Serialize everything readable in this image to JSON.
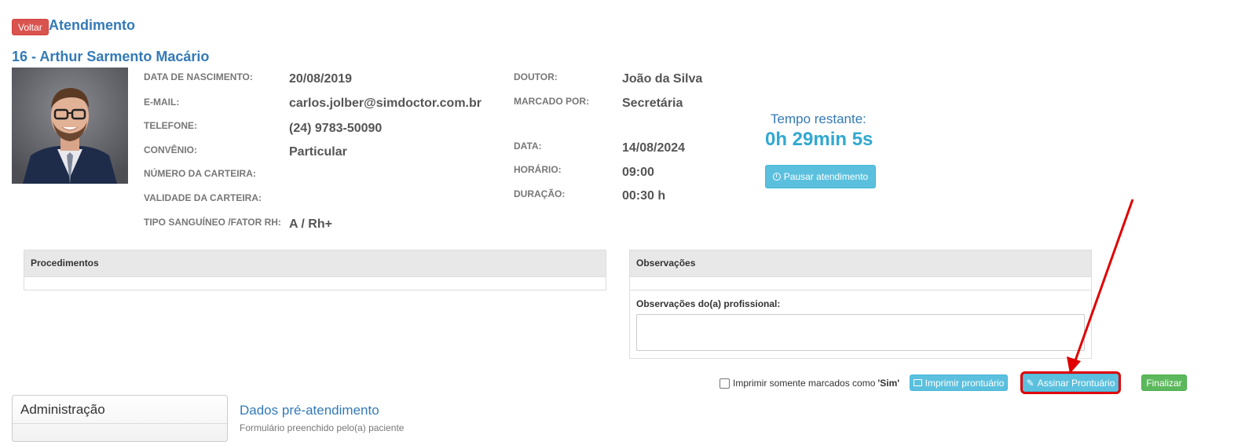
{
  "header": {
    "back_label": "Voltar",
    "title": "Atendimento"
  },
  "patient": {
    "name": "16 - Arthur Sarmento Macário",
    "fields_left": [
      {
        "label": "DATA DE NASCIMENTO:",
        "value": "20/08/2019"
      },
      {
        "label": "E-MAIL:",
        "value": "carlos.jolber@simdoctor.com.br"
      },
      {
        "label": "TELEFONE:",
        "value": "(24) 9783-50090"
      },
      {
        "label": "CONVÊNIO:",
        "value": "Particular"
      },
      {
        "label": "NÚMERO DA CARTEIRA:",
        "value": ""
      },
      {
        "label": "VALIDADE DA CARTEIRA:",
        "value": ""
      },
      {
        "label": "TIPO SANGUÍNEO /FATOR RH:",
        "value": "A / Rh+"
      }
    ],
    "fields_right": [
      {
        "label": "DOUTOR:",
        "value": "João da Silva"
      },
      {
        "label": "MARCADO POR:",
        "value": "Secretária"
      },
      {
        "label": "DATA:",
        "value": "14/08/2024"
      },
      {
        "label": "HORÁRIO:",
        "value": "09:00"
      },
      {
        "label": "DURAÇÃO:",
        "value": "00:30 h"
      }
    ]
  },
  "timer": {
    "label": "Tempo restante:",
    "value": "0h 29min 5s",
    "pause_label": "Pausar atendimento"
  },
  "procedimentos": {
    "title": "Procedimentos"
  },
  "observacoes": {
    "title": "Observações",
    "professional_label": "Observações do(a) profissional:"
  },
  "actions": {
    "checkbox_prefix": "Imprimir somente marcados como ",
    "checkbox_quote": "'Sim'",
    "print_label": "Imprimir prontuário",
    "sign_label": "Assinar Prontuário",
    "finish_label": "Finalizar"
  },
  "sidebar": {
    "title": "Administração"
  },
  "dados": {
    "title": "Dados pré-atendimento",
    "subtitle": "Formulário preenchido pelo(a) paciente"
  },
  "colors": {
    "link_blue": "#337ab7",
    "danger": "#d9534f",
    "info": "#5bc0de",
    "success": "#5cb85c",
    "annotation_red": "#e00000"
  }
}
